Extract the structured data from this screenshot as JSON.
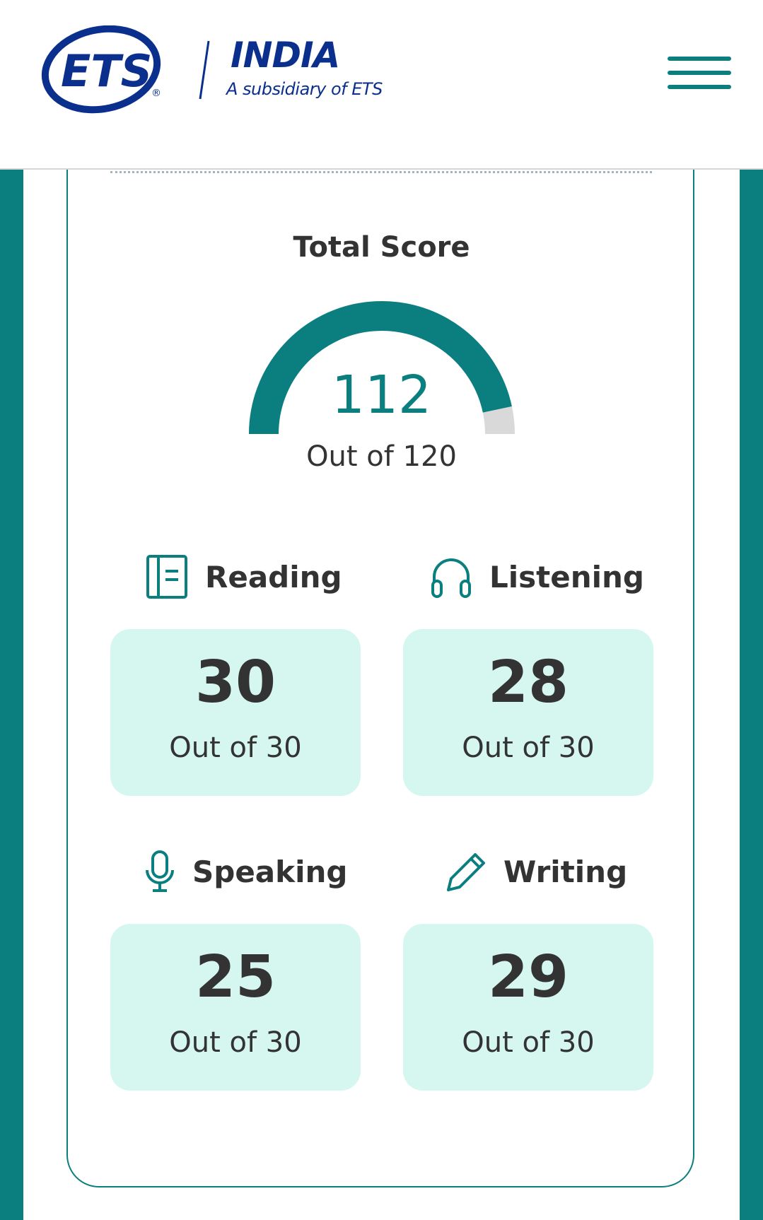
{
  "header": {
    "logo_text": "ETS",
    "brand_title": "INDIA",
    "brand_subtitle": "A subsidiary of ETS",
    "menu_icon": "hamburger-menu-icon"
  },
  "colors": {
    "teal": "#0b7f80",
    "navy": "#0a2f8c",
    "mint": "#d5f7ef",
    "text": "#333333"
  },
  "total": {
    "title": "Total Score",
    "value": "112",
    "out_of": "Out of 120",
    "fraction": 0.9333
  },
  "sections": [
    {
      "label": "Reading",
      "icon": "book-icon",
      "score": "30",
      "out_of": "Out of 30"
    },
    {
      "label": "Listening",
      "icon": "headphones-icon",
      "score": "28",
      "out_of": "Out of 30"
    },
    {
      "label": "Speaking",
      "icon": "microphone-icon",
      "score": "25",
      "out_of": "Out of 30"
    },
    {
      "label": "Writing",
      "icon": "pencil-icon",
      "score": "29",
      "out_of": "Out of 30"
    }
  ]
}
